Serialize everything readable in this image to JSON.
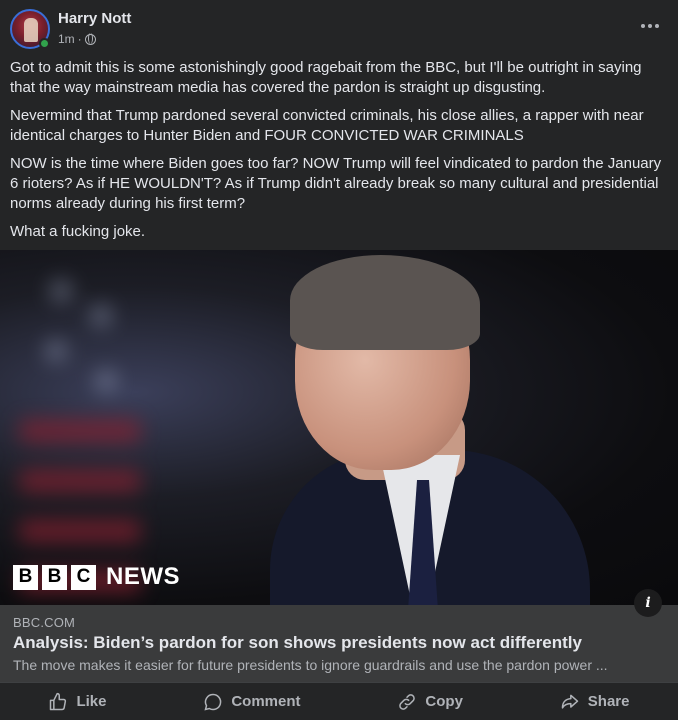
{
  "post": {
    "author": "Harry Nott",
    "time": "1m",
    "dot": "·",
    "paragraphs": [
      "Got to admit this is some astonishingly good ragebait from the BBC, but I'll be outright in saying that the way mainstream media has covered the pardon is straight up disgusting.",
      "Nevermind that Trump pardoned several convicted criminals, his close allies, a rapper with near identical charges to Hunter Biden and FOUR CONVICTED WAR CRIMINALS",
      "NOW is the time where Biden goes too far? NOW Trump will feel vindicated to pardon the January 6 rioters? As if HE WOULDN'T? As if Trump didn't already break so many cultural and presidential norms already during his first term?",
      "What a fucking joke."
    ]
  },
  "image": {
    "logo_letters": [
      "B",
      "B",
      "C"
    ],
    "logo_news": "NEWS"
  },
  "link": {
    "domain": "BBC.COM",
    "headline": "Analysis: Biden’s pardon for son shows presidents now act differently",
    "subtitle": "The move makes it easier for future presidents to ignore guardrails and use the pardon power ...",
    "info": "i"
  },
  "actions": {
    "like": "Like",
    "comment": "Comment",
    "copy": "Copy",
    "share": "Share"
  },
  "icons": {
    "online": "online-status-icon",
    "globe": "globe-icon",
    "more": "more-options-icon",
    "info": "info-icon"
  },
  "colors": {
    "background": "#242526",
    "preview_background": "#3a3b3c",
    "text": "#e4e6eb",
    "muted": "#b0b3b8",
    "online": "#31a24c"
  }
}
